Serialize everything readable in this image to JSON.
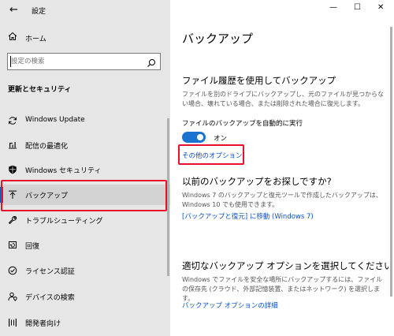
{
  "window": {
    "title": "設定",
    "controls": {
      "minimize": "—",
      "maximize": "☐",
      "close": "✕"
    }
  },
  "sidebar": {
    "home_label": "ホーム",
    "search_placeholder": "設定の検索",
    "section_heading": "更新とセキュリティ",
    "items": [
      {
        "label": "Windows Update",
        "icon": "sync-icon"
      },
      {
        "label": "配信の最適化",
        "icon": "delivery-optimization-icon"
      },
      {
        "label": "Windows セキュリティ",
        "icon": "shield-icon"
      },
      {
        "label": "バックアップ",
        "icon": "backup-icon",
        "selected": true
      },
      {
        "label": "トラブルシューティング",
        "icon": "wrench-icon"
      },
      {
        "label": "回復",
        "icon": "recovery-icon"
      },
      {
        "label": "ライセンス認証",
        "icon": "check-circle-icon"
      },
      {
        "label": "デバイスの検索",
        "icon": "person-location-icon"
      },
      {
        "label": "開発者向け",
        "icon": "developer-icon"
      }
    ]
  },
  "main": {
    "page_title": "バックアップ",
    "file_history": {
      "heading": "ファイル履歴を使用してバックアップ",
      "description": "ファイルを別のドライブにバックアップし、元のファイルが見つからない場合、壊れている場合、または削除された場合に復元します。",
      "auto_backup_label": "ファイルのバックアップを自動的に実行",
      "toggle_state": "オン",
      "more_options_link": "その他のオプション"
    },
    "older_backup": {
      "heading": "以前のバックアップをお探しですか?",
      "description": "Windows 7 のバックアップと復元ツールで作成したバックアップは、Windows 10 でも使用できます。",
      "link": "[バックアップと復元] に移動 (Windows 7)"
    },
    "choose_option": {
      "heading": "適切なバックアップ オプションを選択してください",
      "description": "Windows でファイルを安全な場所にバックアップするには、ファイルの保存先 (クラウド、外部記憶装置、またはネットワーク) を選択します。",
      "link": "バックアップ オプションの詳細"
    }
  },
  "colors": {
    "accent": "#0067c0",
    "link": "#0a4fc2",
    "highlight_border": "#e8102a",
    "sidebar_bg": "#e6e6e6"
  }
}
